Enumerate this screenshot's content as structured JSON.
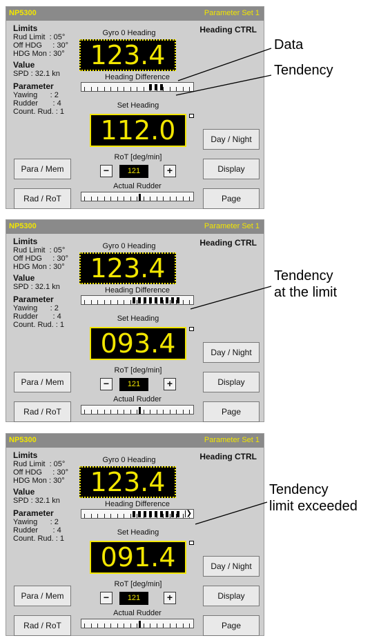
{
  "panels": [
    {
      "title": "NP5300",
      "param_set": "Parameter Set 1",
      "mode": "Heading CTRL",
      "limits_heading": "Limits",
      "limit_lines": [
        "Rud Limit  : 05°",
        "Off HDG     : 30°",
        "HDG Mon : 30°"
      ],
      "value_heading": "Value",
      "speed": "SPD : 32.1 kn",
      "parameter_heading": "Parameter",
      "parameter_lines": [
        "Yawing      : 2",
        "Rudder       : 4",
        "Count. Rud. : 1"
      ],
      "gyro_label": "Gyro 0 Heading",
      "gyro_value": "123.4",
      "hdg_diff_label": "Heading Difference",
      "tendency_fill": 0.35,
      "tendency_exceeded": false,
      "set_heading_label": "Set Heading",
      "set_heading_value": "112.0",
      "rot_label": "RoT [deg/min]",
      "rot_minus": "−",
      "rot_value": "121",
      "rot_plus": "+",
      "actual_rudder_label": "Actual Rudder",
      "actual_rudder_fill": 0.52,
      "buttons": {
        "para_mem": "Para / Mem",
        "rad_rot": "Rad / RoT",
        "day_night": "Day / Night",
        "display": "Display",
        "page": "Page"
      }
    },
    {
      "title": "NP5300",
      "param_set": "Parameter Set 1",
      "mode": "Heading CTRL",
      "limits_heading": "Limits",
      "limit_lines": [
        "Rud Limit  : 05°",
        "Off HDG     : 30°",
        "HDG Mon : 30°"
      ],
      "value_heading": "Value",
      "speed": "SPD : 32.1 kn",
      "parameter_heading": "Parameter",
      "parameter_lines": [
        "Yawing      : 2",
        "Rudder       : 4",
        "Count. Rud. : 1"
      ],
      "gyro_label": "Gyro 0 Heading",
      "gyro_value": "123.4",
      "hdg_diff_label": "Heading Difference",
      "tendency_fill": 1.0,
      "tendency_exceeded": false,
      "set_heading_label": "Set Heading",
      "set_heading_value": "093.4",
      "rot_label": "RoT [deg/min]",
      "rot_minus": "−",
      "rot_value": "121",
      "rot_plus": "+",
      "actual_rudder_label": "Actual Rudder",
      "actual_rudder_fill": 0.52,
      "buttons": {
        "para_mem": "Para / Mem",
        "rad_rot": "Rad / RoT",
        "day_night": "Day / Night",
        "display": "Display",
        "page": "Page"
      }
    },
    {
      "title": "NP5300",
      "param_set": "Parameter Set 1",
      "mode": "Heading CTRL",
      "limits_heading": "Limits",
      "limit_lines": [
        "Rud Limit  : 05°",
        "Off HDG     : 30°",
        "HDG Mon : 30°"
      ],
      "value_heading": "Value",
      "speed": "SPD : 32.1 kn",
      "parameter_heading": "Parameter",
      "parameter_lines": [
        "Yawing      : 2",
        "Rudder       : 4",
        "Count. Rud. : 1"
      ],
      "gyro_label": "Gyro 0 Heading",
      "gyro_value": "123.4",
      "hdg_diff_label": "Heading Difference",
      "tendency_fill": 1.0,
      "tendency_exceeded": true,
      "set_heading_label": "Set Heading",
      "set_heading_value": "091.4",
      "rot_label": "RoT [deg/min]",
      "rot_minus": "−",
      "rot_value": "121",
      "rot_plus": "+",
      "actual_rudder_label": "Actual Rudder",
      "actual_rudder_fill": 0.52,
      "buttons": {
        "para_mem": "Para / Mem",
        "rad_rot": "Rad / RoT",
        "day_night": "Day / Night",
        "display": "Display",
        "page": "Page"
      }
    }
  ],
  "annotations": {
    "data": "Data",
    "tendency": "Tendency",
    "tendency_at_limit_line1": "Tendency",
    "tendency_at_limit_line2": "at the limit",
    "tendency_exceeded_line1": "Tendency",
    "tendency_exceeded_line2": "limit exceeded"
  },
  "colors": {
    "lcd_text": "#f2e600",
    "lcd_bg": "#000000",
    "panel_bg": "#cfcfcf",
    "titlebar": "#8a8a8a"
  },
  "icons": {
    "tendency_exceeded_indicator": "chevron-right-icon"
  }
}
